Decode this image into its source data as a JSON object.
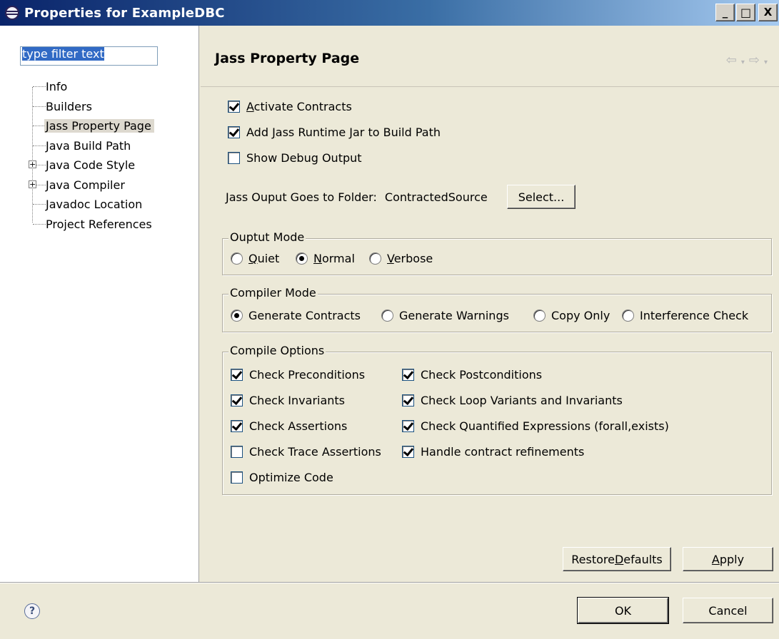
{
  "window": {
    "title": "Properties for ExampleDBC",
    "minimize": "_",
    "maximize": "□",
    "close": "X"
  },
  "filter": {
    "value": "type filter text"
  },
  "tree": {
    "items": [
      {
        "label": "Info",
        "expandable": false
      },
      {
        "label": "Builders",
        "expandable": false
      },
      {
        "label": "Jass Property Page",
        "expandable": false,
        "selected": true
      },
      {
        "label": "Java Build Path",
        "expandable": false
      },
      {
        "label": "Java Code Style",
        "expandable": true
      },
      {
        "label": "Java Compiler",
        "expandable": true
      },
      {
        "label": "Javadoc Location",
        "expandable": false
      },
      {
        "label": "Project References",
        "expandable": false
      }
    ]
  },
  "page": {
    "title": "Jass Property Page",
    "activate_contracts": {
      "label_underlined": "A",
      "label_rest": "ctivate Contracts",
      "checked": true
    },
    "add_runtime_jar": {
      "label_pre": "Add ",
      "label_underlined": "J",
      "label_rest": "ass Runtime Jar to Build Path",
      "checked": true
    },
    "show_debug": {
      "label": "Show Debug Output",
      "checked": false
    },
    "output_folder": {
      "label": "Jass Ouput Goes to Folder:",
      "value": "ContractedSource",
      "select_button": "Select..."
    },
    "output_mode": {
      "title": "Ouptut Mode",
      "options": [
        {
          "underlined": "Q",
          "rest": "uiet",
          "checked": false
        },
        {
          "underlined": "N",
          "rest": "ormal",
          "checked": true
        },
        {
          "underlined": "V",
          "rest": "erbose",
          "checked": false
        }
      ]
    },
    "compiler_mode": {
      "title": "Compiler Mode",
      "options": [
        {
          "label": "Generate Contracts",
          "checked": true
        },
        {
          "label": "Generate Warnings",
          "checked": false
        },
        {
          "label": "Copy Only",
          "checked": false
        },
        {
          "label": "Interference Check",
          "checked": false
        }
      ]
    },
    "compile_options": {
      "title": "Compile Options",
      "left": [
        {
          "label": "Check Preconditions",
          "checked": true
        },
        {
          "label": "Check Invariants",
          "checked": true
        },
        {
          "label": "Check Assertions",
          "checked": true
        },
        {
          "label": "Check Trace Assertions",
          "checked": false
        },
        {
          "label": "Optimize Code",
          "checked": false
        }
      ],
      "right": [
        {
          "label": "Check Postconditions",
          "checked": true
        },
        {
          "label": "Check Loop Variants and Invariants",
          "checked": true
        },
        {
          "label": "Check Quantified Expressions (forall,exists)",
          "checked": true
        },
        {
          "label": "Handle contract refinements",
          "checked": true
        }
      ]
    },
    "restore_defaults": {
      "pre": "Restore ",
      "underlined": "D",
      "rest": "efaults"
    },
    "apply": {
      "underlined": "A",
      "rest": "pply"
    }
  },
  "dialog": {
    "ok": "OK",
    "cancel": "Cancel",
    "help_icon": "question-mark-icon",
    "help_glyph": "?"
  },
  "colors": {
    "titlebar_start": "#0a246a",
    "titlebar_end": "#a6caf0",
    "dialog_bg": "#ece9d8",
    "filter_selection": "#316ac5"
  }
}
